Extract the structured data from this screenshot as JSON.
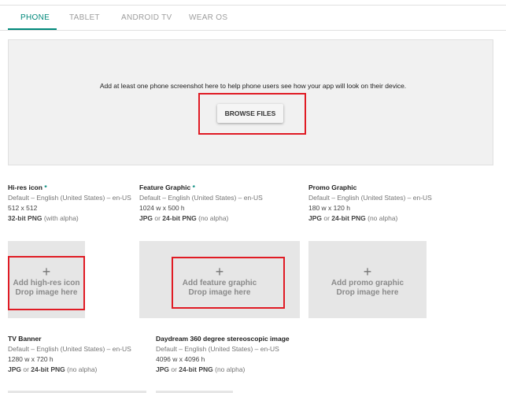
{
  "tabs": [
    {
      "label": "PHONE",
      "active": true
    },
    {
      "label": "TABLET",
      "active": false
    },
    {
      "label": "ANDROID TV",
      "active": false
    },
    {
      "label": "WEAR OS",
      "active": false
    }
  ],
  "upload": {
    "hint": "Add at least one phone screenshot here to help phone users see how your app will look on their device.",
    "browse_label": "BROWSE FILES"
  },
  "assets": {
    "hires": {
      "title": "Hi-res icon",
      "required_mark": "*",
      "lang": "Default – English (United States) – en-US",
      "size": "512 x 512",
      "format_bold": "32-bit PNG",
      "format_rest": " (with alpha)",
      "add_label": "Add high-res icon",
      "drop_label": "Drop image here"
    },
    "feature": {
      "title": "Feature Graphic",
      "required_mark": "*",
      "lang": "Default – English (United States) – en-US",
      "size": "1024 w x 500 h",
      "format_bold1": "JPG",
      "format_mid": " or ",
      "format_bold2": "24-bit PNG",
      "format_rest": " (no alpha)",
      "add_label": "Add feature graphic",
      "drop_label": "Drop image here"
    },
    "promo": {
      "title": "Promo Graphic",
      "lang": "Default – English (United States) – en-US",
      "size": "180 w x 120 h",
      "format_bold1": "JPG",
      "format_mid": " or ",
      "format_bold2": "24-bit PNG",
      "format_rest": " (no alpha)",
      "add_label": "Add promo graphic",
      "drop_label": "Drop image here"
    },
    "tv": {
      "title": "TV Banner",
      "lang": "Default – English (United States) – en-US",
      "size": "1280 w x 720 h",
      "format_bold1": "JPG",
      "format_mid": " or ",
      "format_bold2": "24-bit PNG",
      "format_rest": " (no alpha)"
    },
    "daydream": {
      "title": "Daydream 360 degree stereoscopic image",
      "lang": "Default – English (United States) – en-US",
      "size": "4096 w x 4096 h",
      "format_bold1": "JPG",
      "format_mid": " or ",
      "format_bold2": "24-bit PNG",
      "format_rest": " (no alpha)"
    }
  },
  "plus_glyph": "+",
  "colors": {
    "accent": "#00897b",
    "highlight": "#e01b24"
  }
}
